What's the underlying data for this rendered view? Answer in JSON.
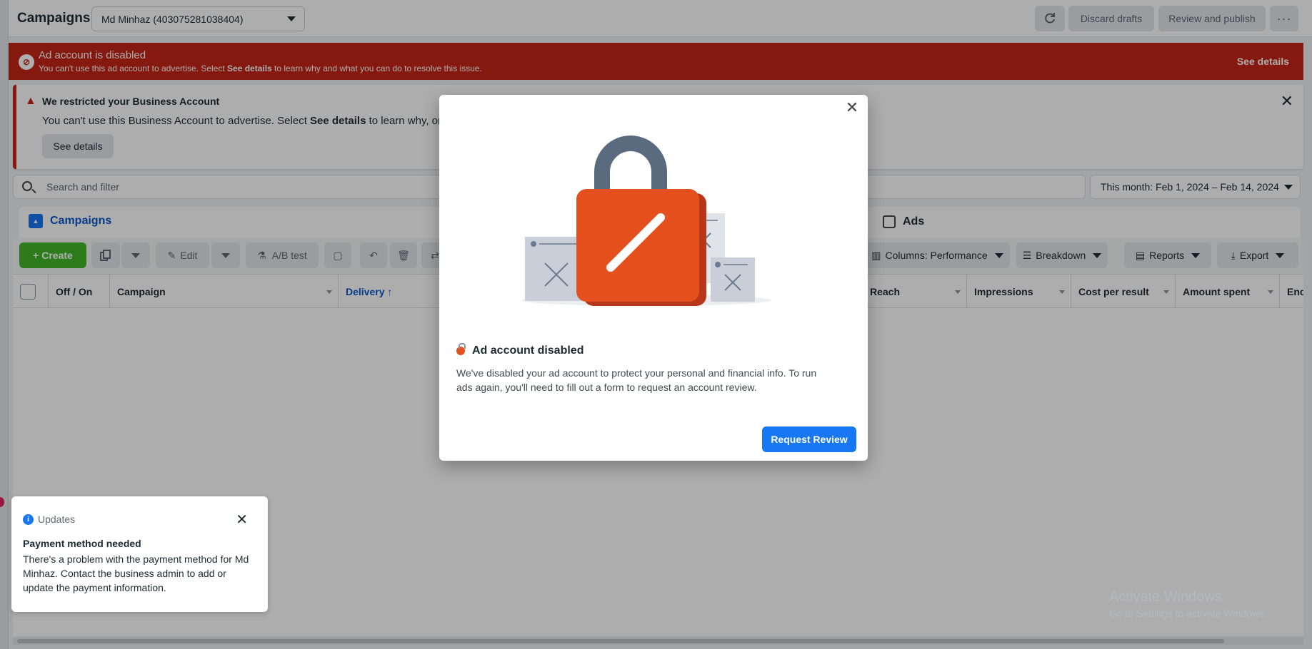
{
  "topbar": {
    "title": "Campaigns",
    "account": "Md Minhaz (403075281038404)",
    "discard_label": "Discard drafts",
    "review_label": "Review and publish",
    "more_label": "···"
  },
  "disabled_banner": {
    "title": "Ad account is disabled",
    "text_before": "You can't use this ad account to advertise. Select ",
    "text_bold": "See details",
    "text_after": " to learn why and what you can do to resolve this issue.",
    "link": "See details"
  },
  "restrict_card": {
    "title": "We restricted your Business Account",
    "text_before": "You can't use this Business Account to advertise. Select ",
    "text_bold": "See details",
    "text_after": " to learn why, or reques",
    "button": "See details"
  },
  "search": {
    "placeholder": "Search and filter"
  },
  "date_range": "This month: Feb 1, 2024 – Feb 14, 2024",
  "tabs": {
    "campaigns": "Campaigns",
    "ads": "Ads"
  },
  "toolbar": {
    "create": "+ Create",
    "edit": "Edit",
    "ab_test": "A/B test",
    "columns": "Columns: Performance",
    "breakdown": "Breakdown",
    "reports": "Reports",
    "export": "Export"
  },
  "table": {
    "columns": {
      "off_on": "Off / On",
      "campaign": "Campaign",
      "delivery": "Delivery ↑",
      "reach": "Reach",
      "impressions": "Impressions",
      "cost_per_result": "Cost per result",
      "amount_spent": "Amount spent",
      "ends": "End"
    }
  },
  "modal": {
    "title": "Ad account disabled",
    "body": "We've disabled your ad account to protect your personal and financial info. To run ads again, you'll need to fill out a form to request an account review.",
    "button": "Request Review"
  },
  "updates": {
    "header": "Updates",
    "title": "Payment method needed",
    "body": "There's a problem with the payment method for Md Minhaz. Contact the business admin to add or update the payment information."
  },
  "watermark": {
    "line1": "Activate Windows",
    "line2": "Go to Settings to activate Windows."
  },
  "colors": {
    "banner_red": "#c42417",
    "brand_blue": "#1877f2",
    "create_green": "#42b72a",
    "lock_orange": "#e4501e"
  }
}
